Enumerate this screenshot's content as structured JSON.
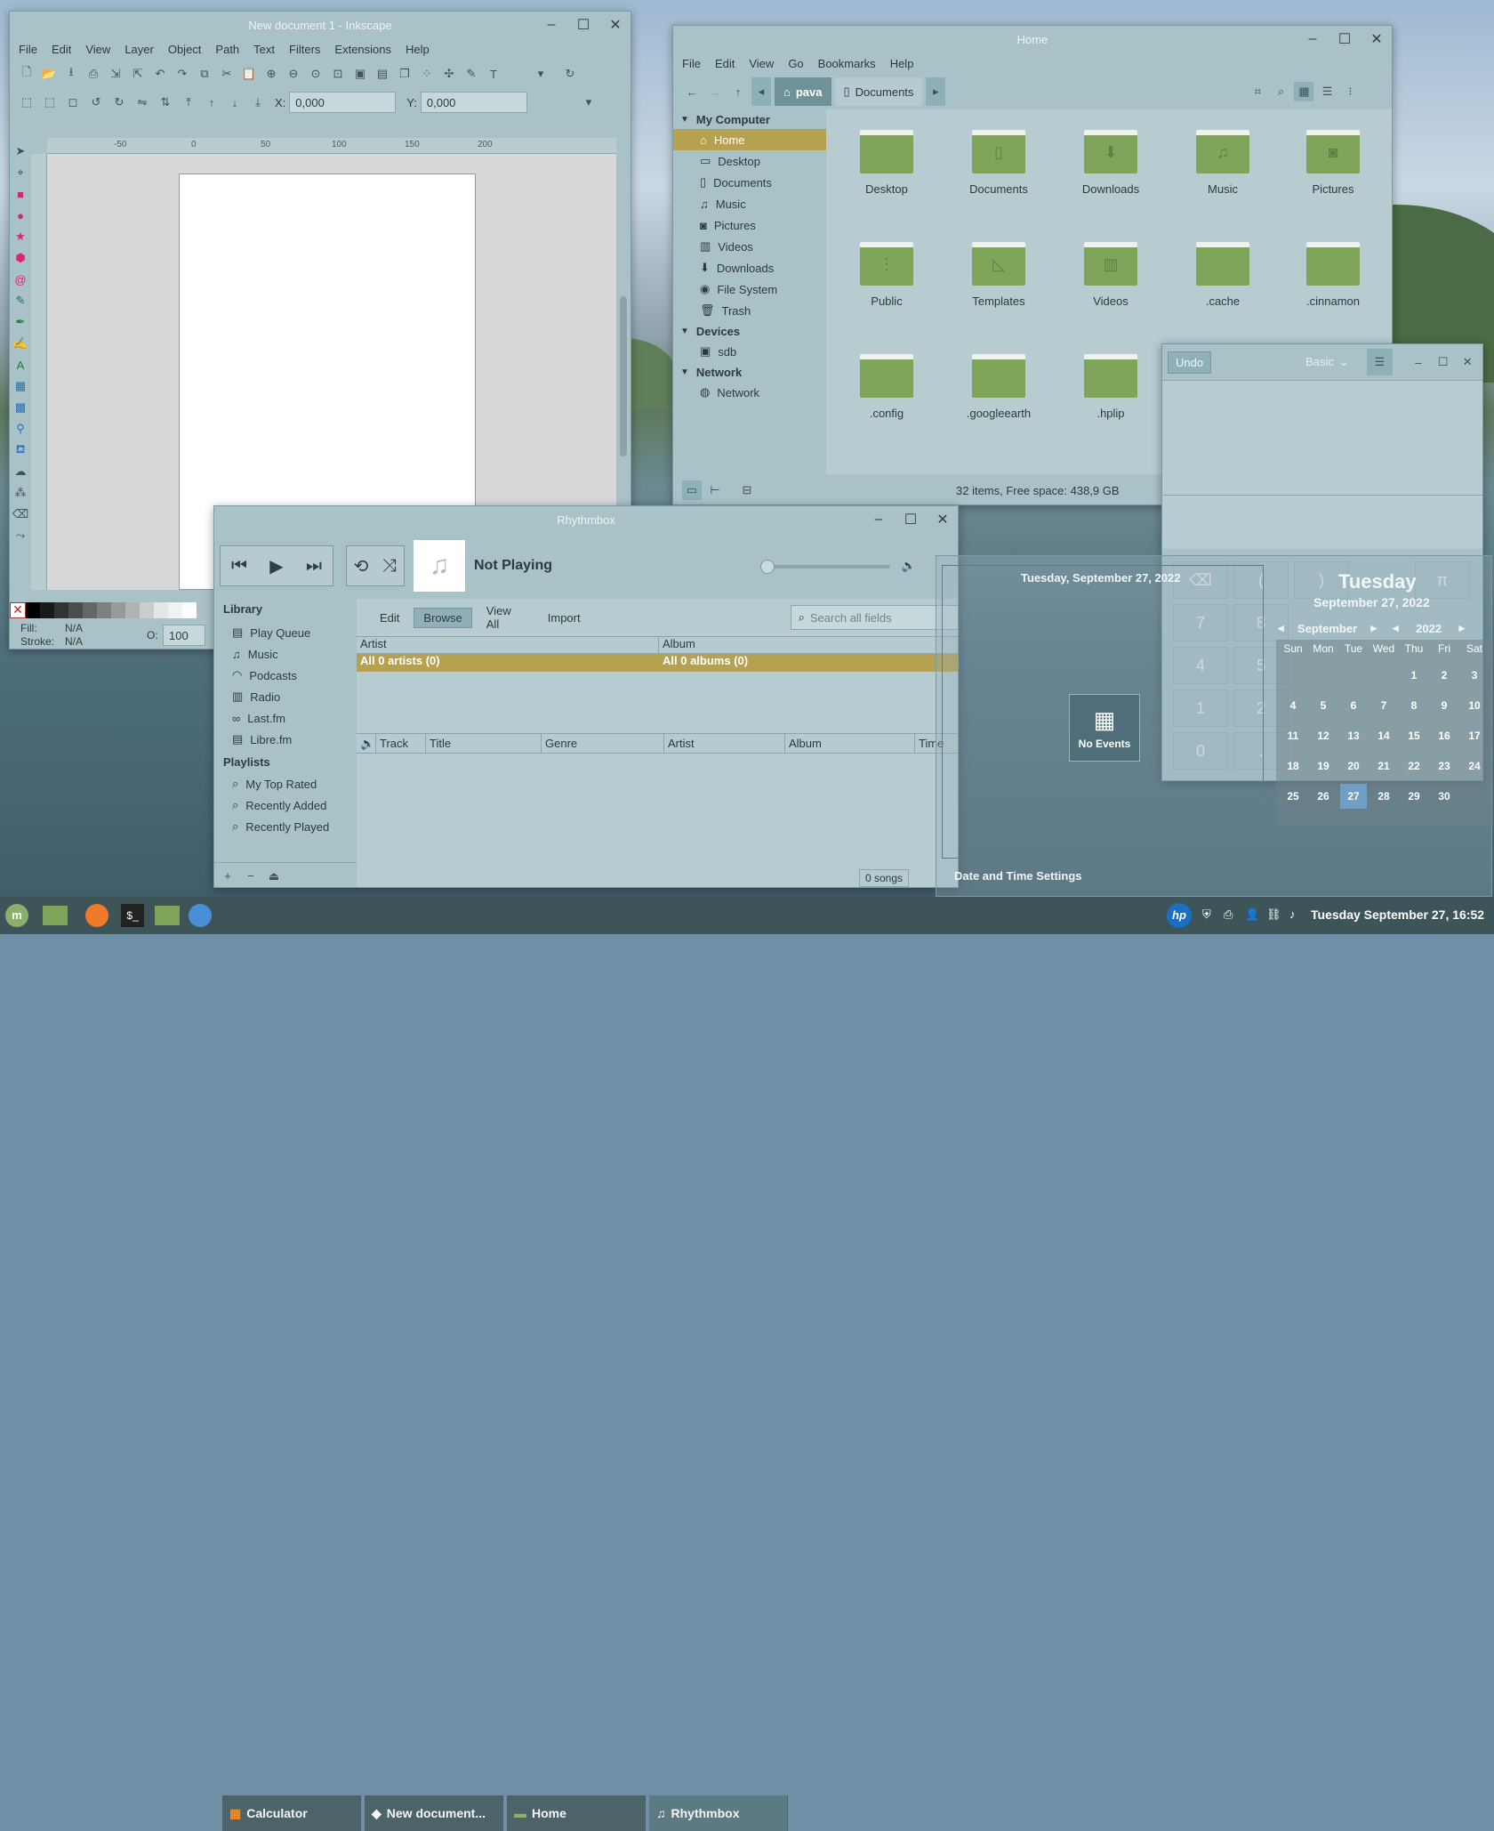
{
  "inkscape": {
    "title": "New document 1 - Inkscape",
    "menu": [
      "File",
      "Edit",
      "View",
      "Layer",
      "Object",
      "Path",
      "Text",
      "Filters",
      "Extensions",
      "Help"
    ],
    "x_label": "X:",
    "x_value": "0,000",
    "y_label": "Y:",
    "y_value": "0,000",
    "ruler_ticks": [
      "-50",
      "0",
      "50",
      "100",
      "150",
      "200"
    ],
    "fill_label": "Fill:",
    "fill_value": "N/A",
    "stroke_label": "Stroke:",
    "stroke_value": "N/A",
    "opacity_label": "O:",
    "opacity_value": "100"
  },
  "files": {
    "title": "Home",
    "menu": [
      "File",
      "Edit",
      "View",
      "Go",
      "Bookmarks",
      "Help"
    ],
    "path": [
      "pava",
      "Documents"
    ],
    "sidebar": {
      "sections": [
        {
          "label": "My Computer",
          "items": [
            {
              "label": "Home",
              "icon": "home-icon"
            },
            {
              "label": "Desktop",
              "icon": "desktop-icon"
            },
            {
              "label": "Documents",
              "icon": "document-icon"
            },
            {
              "label": "Music",
              "icon": "music-icon"
            },
            {
              "label": "Pictures",
              "icon": "camera-icon"
            },
            {
              "label": "Videos",
              "icon": "film-icon"
            },
            {
              "label": "Downloads",
              "icon": "download-icon"
            },
            {
              "label": "File System",
              "icon": "disk-icon"
            },
            {
              "label": "Trash",
              "icon": "trash-icon"
            }
          ]
        },
        {
          "label": "Devices",
          "items": [
            {
              "label": "sdb",
              "icon": "drive-icon"
            }
          ]
        },
        {
          "label": "Network",
          "items": [
            {
              "label": "Network",
              "icon": "globe-icon"
            }
          ]
        }
      ]
    },
    "folders": [
      "Desktop",
      "Documents",
      "Downloads",
      "Music",
      "Pictures",
      "Public",
      "Templates",
      "Videos",
      ".cache",
      ".cinnamon",
      ".config",
      ".googleearth",
      ".hplip"
    ],
    "status": "32 items, Free space: 438,9 GB"
  },
  "calculator": {
    "undo_label": "Undo",
    "mode_label": "Basic",
    "keys": [
      "(",
      ")",
      "π",
      "7",
      "8",
      "4",
      "5",
      "1",
      "2",
      "0",
      "."
    ]
  },
  "rhythmbox": {
    "title": "Rhythmbox",
    "now_playing": "Not Playing",
    "tabs": [
      "Edit",
      "Browse",
      "View All",
      "Import"
    ],
    "search_placeholder": "Search all fields",
    "library_label": "Library",
    "library_items": [
      "Play Queue",
      "Music",
      "Podcasts",
      "Radio",
      "Last.fm",
      "Libre.fm"
    ],
    "playlists_label": "Playlists",
    "playlist_items": [
      "My Top Rated",
      "Recently Added",
      "Recently Played"
    ],
    "artist_header": "Artist",
    "album_header": "Album",
    "all_artists": "All 0 artists (0)",
    "all_albums": "All 0 albums (0)",
    "columns": [
      "Track",
      "Title",
      "Genre",
      "Artist",
      "Album",
      "Time"
    ],
    "song_count": "0 songs"
  },
  "calendar": {
    "date_line": "Tuesday, September 27, 2022",
    "weekday": "Tuesday",
    "full_date": "September 27, 2022",
    "month": "September",
    "year": "2022",
    "day_headers": [
      "Sun",
      "Mon",
      "Tue",
      "Wed",
      "Thu",
      "Fri",
      "Sat"
    ],
    "weeks": [
      [
        "",
        "",
        "",
        "",
        "1",
        "2",
        "3"
      ],
      [
        "4",
        "5",
        "6",
        "7",
        "8",
        "9",
        "10"
      ],
      [
        "11",
        "12",
        "13",
        "14",
        "15",
        "16",
        "17"
      ],
      [
        "18",
        "19",
        "20",
        "21",
        "22",
        "23",
        "24"
      ],
      [
        "25",
        "26",
        "27",
        "28",
        "29",
        "30",
        ""
      ]
    ],
    "today": "27",
    "no_events": "No Events",
    "settings_link": "Date and Time Settings"
  },
  "taskbar": {
    "windows": [
      "Calculator",
      "New document...",
      "Home",
      "Rhythmbox"
    ],
    "clock": "Tuesday September 27, 16:52"
  },
  "colors": {
    "accent": "#b5a14f",
    "today": "#6f9fc4",
    "panel": "#3d5459"
  }
}
